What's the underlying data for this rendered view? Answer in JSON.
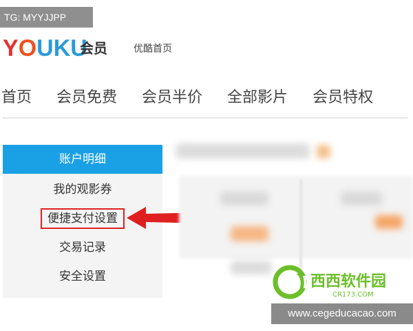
{
  "watermark": {
    "tag": "TG: MYYJJPP",
    "site_url": "www.cegeducacao.com",
    "site_logo_cn": "西西软件园",
    "site_logo_en": "CR173.COM"
  },
  "header": {
    "logo_text": "YOUKU",
    "logo_member": "会员",
    "home_link": "优酷首页"
  },
  "main_nav": {
    "items": [
      {
        "label": "首页"
      },
      {
        "label": "会员免费"
      },
      {
        "label": "会员半价"
      },
      {
        "label": "全部影片"
      },
      {
        "label": "会员特权"
      }
    ]
  },
  "side_menu": {
    "items": [
      {
        "label": "账户明细",
        "active": true
      },
      {
        "label": "我的观影券"
      },
      {
        "label": "便捷支付设置",
        "highlighted": true
      },
      {
        "label": "交易记录"
      },
      {
        "label": "安全设置"
      }
    ]
  },
  "colors": {
    "accent_blue": "#1aa0e5",
    "highlight_red": "#e02020",
    "youku_red": "#e8312e",
    "youku_blue": "#2a9ad8"
  }
}
